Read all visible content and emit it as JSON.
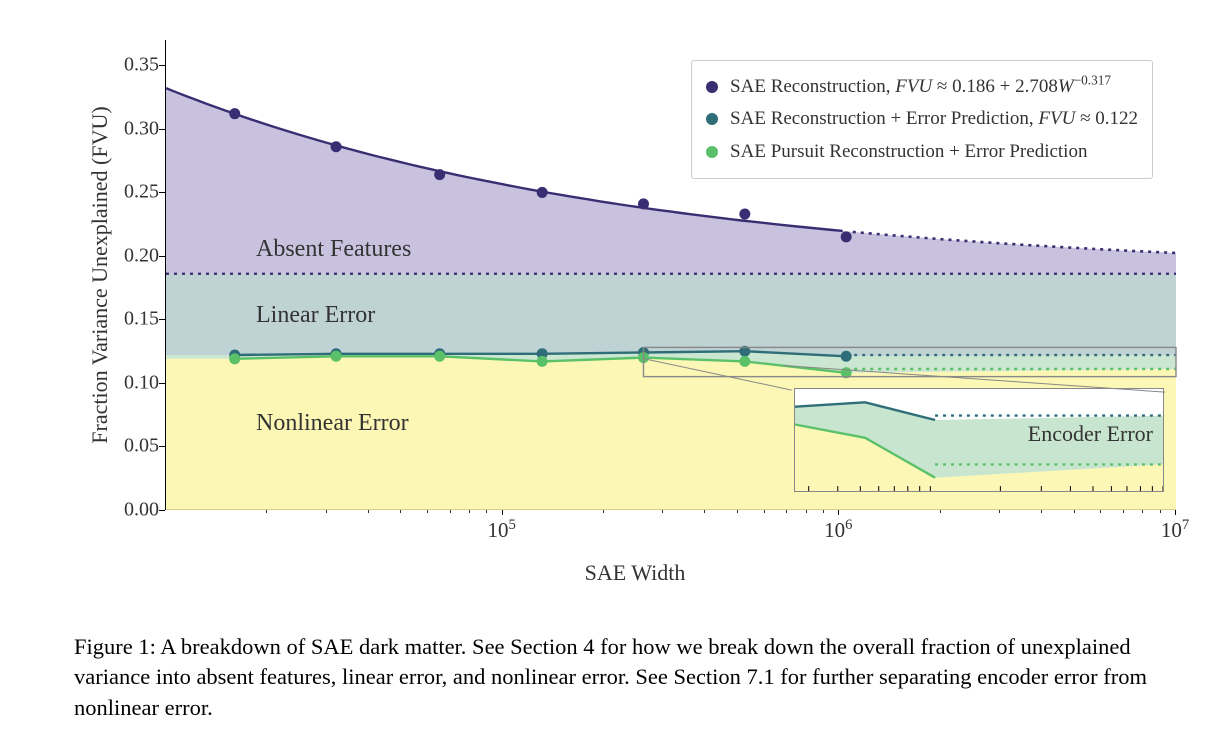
{
  "chart_data": {
    "type": "area",
    "xscale": "log",
    "xlim": [
      10000,
      10000000
    ],
    "ylim": [
      0,
      0.37
    ],
    "xlabel": "SAE Width",
    "ylabel": "Fraction Variance Unexplained (FVU)",
    "x_ticks": [
      100000,
      1000000,
      10000000
    ],
    "x_tick_labels_html": [
      "10<sup>5</sup>",
      "10<sup>6</sup>",
      "10<sup>7</sup>"
    ],
    "y_ticks": [
      0.0,
      0.05,
      0.1,
      0.15,
      0.2,
      0.25,
      0.3,
      0.35
    ],
    "y_tick_labels": [
      "0.00",
      "0.05",
      "0.10",
      "0.15",
      "0.20",
      "0.25",
      "0.30",
      "0.35"
    ],
    "series": [
      {
        "name": "SAE Reconstruction",
        "color": "#3a2e72",
        "marker": "circle",
        "formula_html": "<span class='ital'>FVU</span> ≈ 0.186 + 2.708<span class='ital'>W</span><sup>−0.317</sup>",
        "x": [
          16000,
          32000,
          65000,
          131000,
          262000,
          524000,
          1048000
        ],
        "y": [
          0.312,
          0.286,
          0.264,
          0.25,
          0.241,
          0.233,
          0.215
        ],
        "fit": true,
        "asymptote": 0.186
      },
      {
        "name": "SAE Reconstruction + Error Prediction",
        "color": "#2f6e78",
        "formula_html": "<span class='ital'>FVU</span> ≈ 0.122",
        "x": [
          16000,
          32000,
          65000,
          131000,
          262000,
          524000,
          1048000
        ],
        "y": [
          0.122,
          0.123,
          0.123,
          0.123,
          0.124,
          0.125,
          0.121
        ],
        "asymptote": 0.122
      },
      {
        "name": "SAE Pursuit Reconstruction + Error Prediction",
        "color": "#5bc169",
        "x": [
          16000,
          32000,
          65000,
          131000,
          262000,
          524000,
          1048000
        ],
        "y": [
          0.119,
          0.121,
          0.121,
          0.117,
          0.12,
          0.117,
          0.108
        ],
        "asymptote": 0.111
      }
    ],
    "region_labels": [
      {
        "text": "Absent Features",
        "zone": "top"
      },
      {
        "text": "Linear Error",
        "zone": "mid"
      },
      {
        "text": "Nonlinear Error",
        "zone": "bottom"
      }
    ],
    "inset": {
      "label": "Encoder Error",
      "xlim": [
        262000,
        10000000
      ],
      "ylim": [
        0.105,
        0.128
      ]
    },
    "fills": {
      "absent_features": "#b5add4",
      "linear_error": "#a9c3c6",
      "nonlinear_error": "#fbf6a7",
      "encoder_error": "#b9dfc3"
    }
  },
  "legend": {
    "items": [
      {
        "label_html": "SAE Reconstruction, <span class='ital'>FVU</span> ≈ 0.186 + 2.708<span class='ital'>W</span><sup>−0.317</sup>",
        "color": "#3a2e72"
      },
      {
        "label_html": "SAE Reconstruction + Error Prediction, <span class='ital'>FVU</span> ≈ 0.122",
        "color": "#2f6e78"
      },
      {
        "label_html": "SAE Pursuit Reconstruction + Error Prediction",
        "color": "#5bc169"
      }
    ]
  },
  "caption_html": "Figure 1: A breakdown of SAE dark matter. See Section 4 for how we break down the overall fraction of unexplained variance into absent features, linear error, and nonlinear error. See Section 7.1 for further separating encoder error from nonlinear error."
}
